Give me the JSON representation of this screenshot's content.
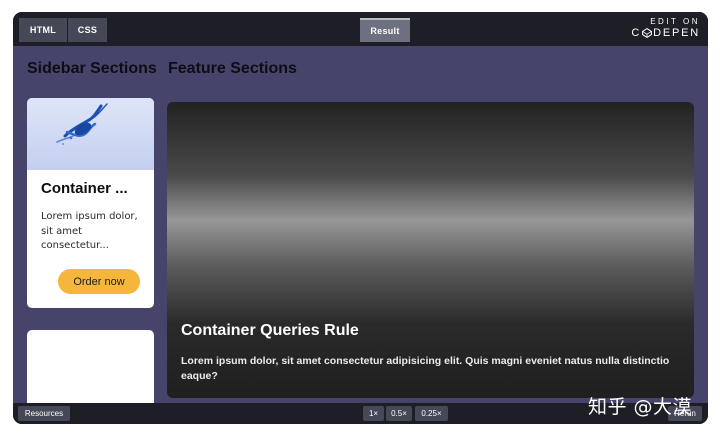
{
  "editor": {
    "tabs": [
      "HTML",
      "CSS"
    ],
    "result_tab": "Result",
    "brand_top": "EDIT ON",
    "brand_name_pre": "C",
    "brand_name_post": "DEPEN"
  },
  "page": {
    "sidebar_heading": "Sidebar Sections",
    "feature_heading": "Feature Sections"
  },
  "card": {
    "title": "Container ...",
    "text": "Lorem ipsum dolor, sit amet consectetur...",
    "button": "Order now"
  },
  "feature": {
    "title": "Container Queries Rule",
    "text": "Lorem ipsum dolor, sit amet consectetur adipisicing elit. Quis magni eveniet natus nulla distinctio eaque?"
  },
  "footer": {
    "resources": "Resources",
    "zoom_options": [
      "1×",
      "0.5×",
      "0.25×"
    ],
    "rerun": "Rerun"
  },
  "watermark": "知乎 @大漠",
  "colors": {
    "chrome": "#1e1f26",
    "tab": "#444857",
    "result_bg": "#47446b",
    "button_accent": "#f4b63b"
  }
}
